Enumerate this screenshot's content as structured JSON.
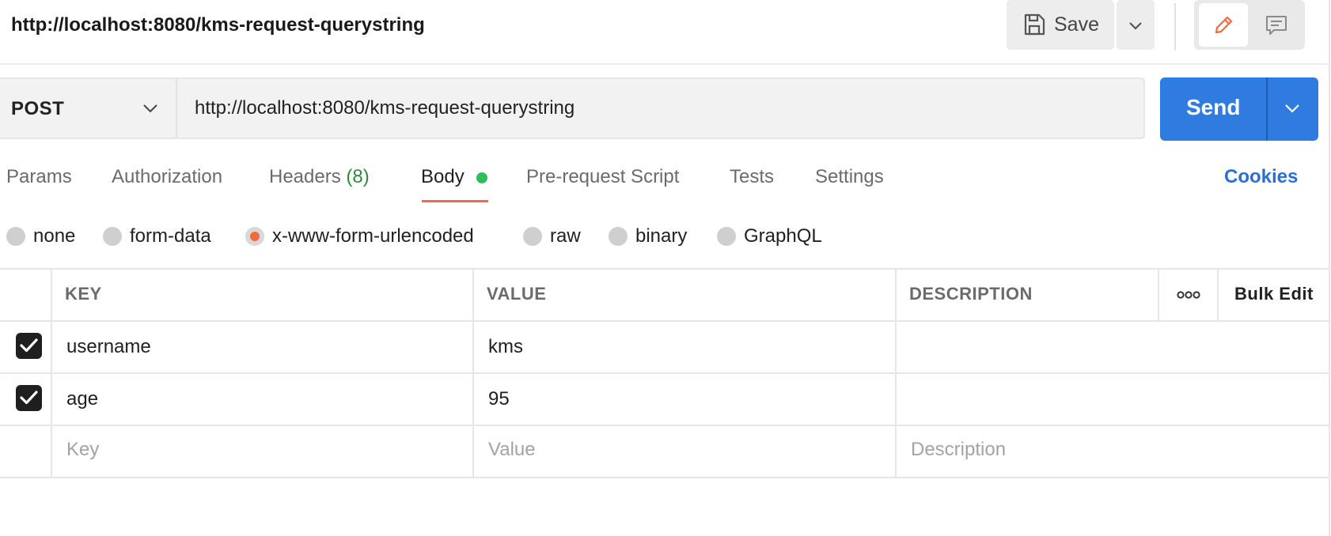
{
  "request": {
    "title": "http://localhost:8080/kms-request-querystring",
    "method": "POST",
    "url": "http://localhost:8080/kms-request-querystring"
  },
  "toolbar": {
    "save_label": "Save",
    "send_label": "Send"
  },
  "tabs": [
    {
      "label": "Params"
    },
    {
      "label": "Authorization"
    },
    {
      "label": "Headers",
      "count": "(8)"
    },
    {
      "label": "Body",
      "active": true
    },
    {
      "label": "Pre-request Script"
    },
    {
      "label": "Tests"
    },
    {
      "label": "Settings"
    }
  ],
  "cookies_label": "Cookies",
  "body_types": [
    {
      "label": "none"
    },
    {
      "label": "form-data"
    },
    {
      "label": "x-www-form-urlencoded",
      "selected": true
    },
    {
      "label": "raw"
    },
    {
      "label": "binary"
    },
    {
      "label": "GraphQL"
    }
  ],
  "table": {
    "headers": {
      "key": "KEY",
      "value": "VALUE",
      "description": "DESCRIPTION",
      "bulk_edit": "Bulk Edit"
    },
    "rows": [
      {
        "checked": true,
        "key": "username",
        "value": "kms",
        "description": ""
      },
      {
        "checked": true,
        "key": "age",
        "value": "95",
        "description": ""
      }
    ],
    "placeholders": {
      "key": "Key",
      "value": "Value",
      "description": "Description"
    }
  },
  "colors": {
    "accent": "#f26b3a",
    "send": "#2f7be0",
    "link": "#2a6fd6",
    "status_dot": "#2fbf5a",
    "count": "#2e8b3a"
  }
}
